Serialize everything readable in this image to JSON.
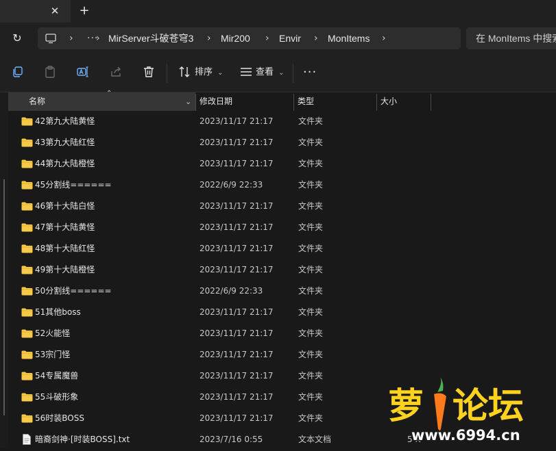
{
  "titlebar": {
    "close_glyph": "✕",
    "new_tab_glyph": "+"
  },
  "address": {
    "refresh_glyph": "↻",
    "more_glyph": "···",
    "separator": "›",
    "crumbs": [
      "MirServer斗破苍穹3",
      "Mir200",
      "Envir",
      "MonItems"
    ]
  },
  "search": {
    "placeholder": "在 MonItems 中搜索"
  },
  "toolbar": {
    "sort_label": "排序",
    "view_label": "查看",
    "more_glyph": "···",
    "dropdown_glyph": "⌄",
    "icons": [
      "copy-icon",
      "paste-icon",
      "rename-icon",
      "share-icon",
      "delete-icon",
      "sort-icon",
      "view-icon"
    ]
  },
  "columns": {
    "name": "名称",
    "modified": "修改日期",
    "type": "类型",
    "size": "大小"
  },
  "rows": [
    {
      "name": "42第九大陆黄怪",
      "date": "2023/11/17 21:17",
      "type": "文件夹",
      "size": "",
      "icon": "folder-icon"
    },
    {
      "name": "43第九大陆红怪",
      "date": "2023/11/17 21:17",
      "type": "文件夹",
      "size": "",
      "icon": "folder-icon"
    },
    {
      "name": "44第九大陆橙怪",
      "date": "2023/11/17 21:17",
      "type": "文件夹",
      "size": "",
      "icon": "folder-icon"
    },
    {
      "name": "45分割线======",
      "date": "2022/6/9 22:33",
      "type": "文件夹",
      "size": "",
      "icon": "folder-icon"
    },
    {
      "name": "46第十大陆白怪",
      "date": "2023/11/17 21:17",
      "type": "文件夹",
      "size": "",
      "icon": "folder-icon"
    },
    {
      "name": "47第十大陆黄怪",
      "date": "2023/11/17 21:17",
      "type": "文件夹",
      "size": "",
      "icon": "folder-icon"
    },
    {
      "name": "48第十大陆红怪",
      "date": "2023/11/17 21:17",
      "type": "文件夹",
      "size": "",
      "icon": "folder-icon"
    },
    {
      "name": "49第十大陆橙怪",
      "date": "2023/11/17 21:17",
      "type": "文件夹",
      "size": "",
      "icon": "folder-icon"
    },
    {
      "name": "50分割线======",
      "date": "2022/6/9 22:33",
      "type": "文件夹",
      "size": "",
      "icon": "folder-icon"
    },
    {
      "name": "51其他boss",
      "date": "2023/11/17 21:17",
      "type": "文件夹",
      "size": "",
      "icon": "folder-icon"
    },
    {
      "name": "52火能怪",
      "date": "2023/11/17 21:17",
      "type": "文件夹",
      "size": "",
      "icon": "folder-icon"
    },
    {
      "name": "53宗门怪",
      "date": "2023/11/17 21:17",
      "type": "文件夹",
      "size": "",
      "icon": "folder-icon"
    },
    {
      "name": "54专属魔兽",
      "date": "2023/11/17 21:17",
      "type": "文件夹",
      "size": "",
      "icon": "folder-icon"
    },
    {
      "name": "55斗破形象",
      "date": "2023/11/17 21:17",
      "type": "文件夹",
      "size": "",
      "icon": "folder-icon"
    },
    {
      "name": "56时装BOSS",
      "date": "2023/11/17 21:17",
      "type": "文件夹",
      "size": "",
      "icon": "folder-icon"
    },
    {
      "name": "暗裔剑神·[时装BOSS].txt",
      "date": "2023/7/16 0:55",
      "type": "文本文档",
      "size": "5 K",
      "icon": "text-file-icon"
    }
  ],
  "watermark": {
    "title": "萝卜论坛",
    "url": "www.6994.cn"
  },
  "colors": {
    "folder": "#f7c948",
    "background": "#191919",
    "header_selected": "#363636"
  }
}
